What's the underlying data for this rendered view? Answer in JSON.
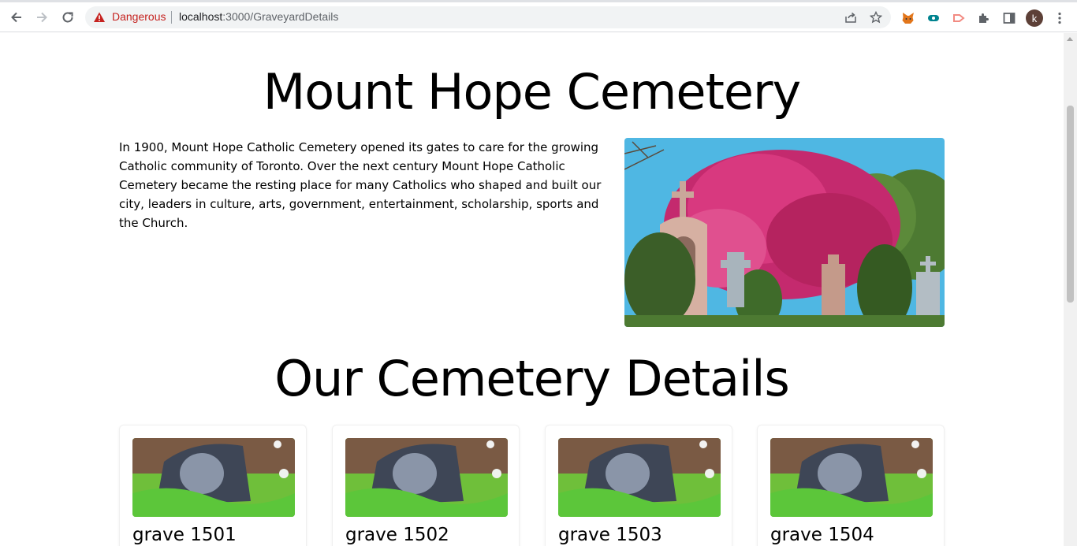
{
  "browser": {
    "security_label": "Dangerous",
    "url_host": "localhost",
    "url_path": ":3000/GraveyardDetails",
    "profile_initial": "k"
  },
  "main": {
    "title": "Mount Hope Cemetery",
    "intro": "In 1900, Mount Hope Catholic Cemetery opened its gates to care for the growing Catholic community of Toronto. Over the next century Mount Hope Catholic Cemetery became the resting place for many Catholics who shaped and built our city, leaders in culture, arts, government, entertainment, scholarship, sports and the Church.",
    "section_title": "Our Cemetery Details",
    "graves": [
      {
        "name": "grave 1501"
      },
      {
        "name": "grave 1502"
      },
      {
        "name": "grave 1503"
      },
      {
        "name": "grave 1504"
      }
    ]
  },
  "colors": {
    "danger": "#c5221f",
    "sky": "#4fb7e3",
    "blossom": "#d4307a",
    "foliage": "#3f6b2a"
  }
}
